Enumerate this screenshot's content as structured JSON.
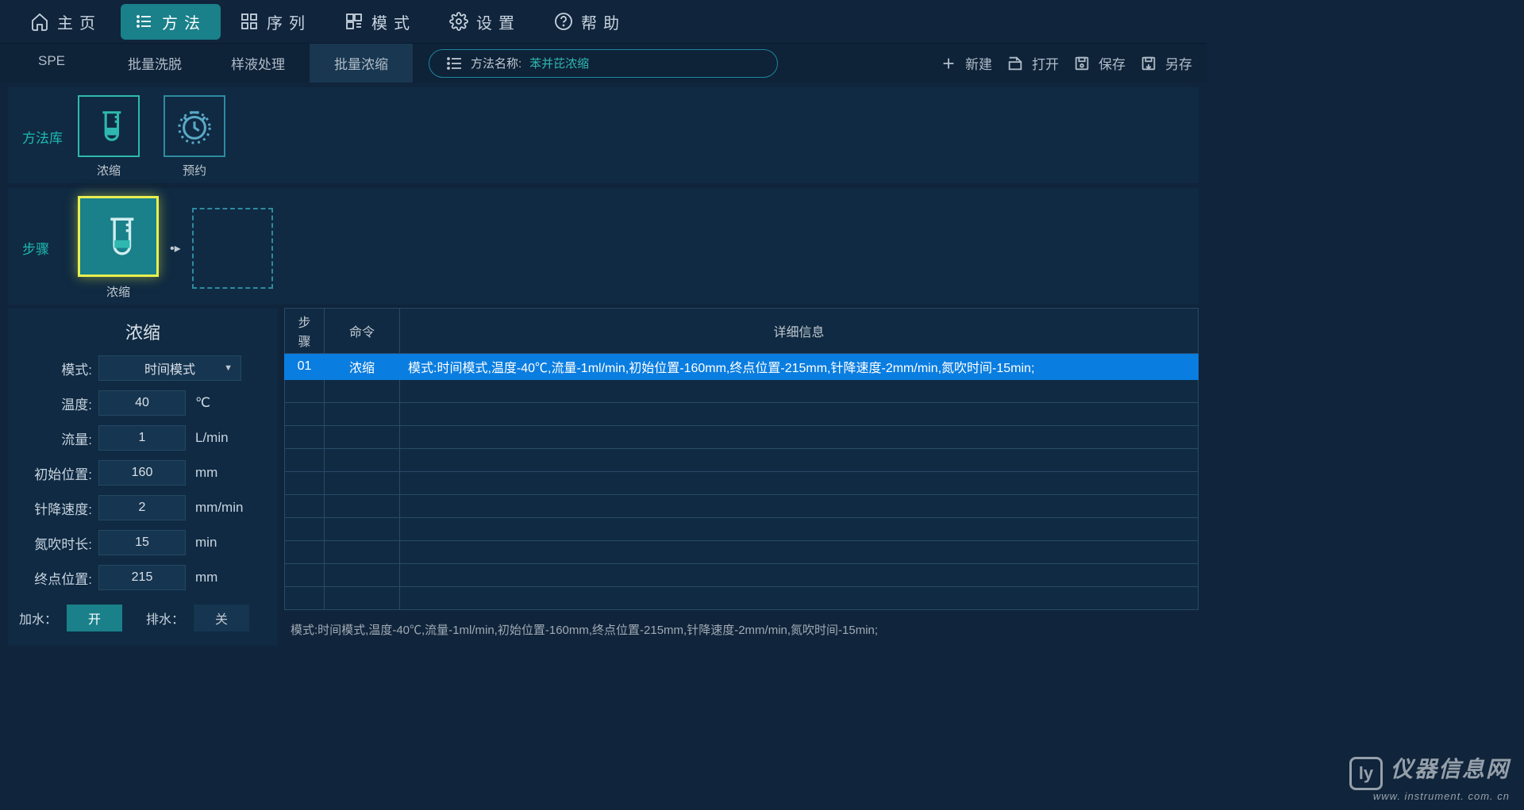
{
  "topnav": [
    {
      "icon": "home",
      "label": "主页"
    },
    {
      "icon": "list",
      "label": "方法",
      "active": true
    },
    {
      "icon": "grid",
      "label": "序列"
    },
    {
      "icon": "qr",
      "label": "模式"
    },
    {
      "icon": "gear",
      "label": "设置"
    },
    {
      "icon": "help",
      "label": "帮助"
    }
  ],
  "subtabs": [
    "SPE",
    "批量洗脱",
    "样液处理",
    "批量浓缩"
  ],
  "active_subtab": 3,
  "method_name_label": "方法名称:",
  "method_name_value": "苯并芘浓缩",
  "actions": [
    {
      "icon": "plus",
      "label": "新建"
    },
    {
      "icon": "open",
      "label": "打开"
    },
    {
      "icon": "save",
      "label": "保存"
    },
    {
      "icon": "saveas",
      "label": "另存"
    }
  ],
  "library_label": "方法库",
  "library_items": [
    {
      "name": "浓缩",
      "icon": "tube",
      "active": true
    },
    {
      "name": "预约",
      "icon": "clock"
    }
  ],
  "steps_label": "步骤",
  "steps": [
    {
      "name": "浓缩",
      "selected": true
    }
  ],
  "form": {
    "title": "浓缩",
    "mode_label": "模式:",
    "mode_value": "时间模式",
    "temp_label": "温度:",
    "temp_value": "40",
    "temp_unit": "℃",
    "flow_label": "流量:",
    "flow_value": "1",
    "flow_unit": "L/min",
    "initpos_label": "初始位置:",
    "initpos_value": "160",
    "initpos_unit": "mm",
    "needlespeed_label": "针降速度:",
    "needlespeed_value": "2",
    "needlespeed_unit": "mm/min",
    "n2time_label": "氮吹时长:",
    "n2time_value": "15",
    "n2time_unit": "min",
    "endpos_label": "终点位置:",
    "endpos_value": "215",
    "endpos_unit": "mm",
    "water_in_label": "加水：",
    "water_in_value": "开",
    "water_out_label": "排水：",
    "water_out_value": "关"
  },
  "table": {
    "headers": [
      "步骤",
      "命令",
      "详细信息"
    ],
    "rows": [
      {
        "step": "01",
        "cmd": "浓缩",
        "detail": "模式:时间模式,温度-40℃,流量-1ml/min,初始位置-160mm,终点位置-215mm,针降速度-2mm/min,氮吹时间-15min;",
        "selected": true
      }
    ],
    "empty_rows": 10
  },
  "status_line": "模式:时间模式,温度-40℃,流量-1ml/min,初始位置-160mm,终点位置-215mm,针降速度-2mm/min,氮吹时间-15min;",
  "watermark": {
    "line1": "仪器信息网",
    "line2": "www. instrument. com. cn"
  }
}
